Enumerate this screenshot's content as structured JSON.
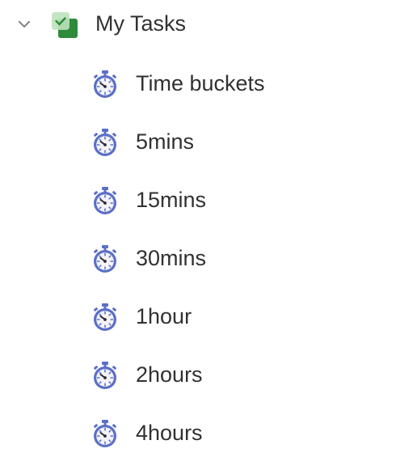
{
  "list": {
    "title": "My Tasks",
    "expanded": true,
    "icon": "checkbox-list-icon",
    "icon_color_front": "#2e8b3a",
    "icon_color_back": "#b8ddb8",
    "children": [
      {
        "label": "Time buckets",
        "icon": "stopwatch-icon"
      },
      {
        "label": "5mins",
        "icon": "stopwatch-icon"
      },
      {
        "label": "15mins",
        "icon": "stopwatch-icon"
      },
      {
        "label": "30mins",
        "icon": "stopwatch-icon"
      },
      {
        "label": "1hour",
        "icon": "stopwatch-icon"
      },
      {
        "label": "2hours",
        "icon": "stopwatch-icon"
      },
      {
        "label": "4hours",
        "icon": "stopwatch-icon"
      }
    ]
  },
  "colors": {
    "text": "#323130",
    "chevron": "#8a8886",
    "stopwatch": "#5b6fc7"
  }
}
